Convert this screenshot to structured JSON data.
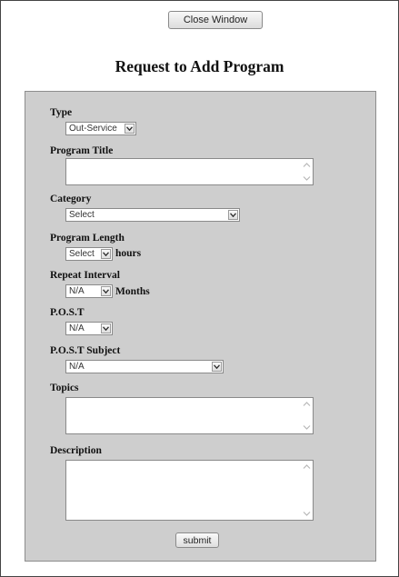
{
  "window": {
    "close_label": "Close Window"
  },
  "page": {
    "title": "Request to Add Program"
  },
  "form": {
    "type": {
      "label": "Type",
      "value": "Out-Service"
    },
    "program_title": {
      "label": "Program Title",
      "value": ""
    },
    "category": {
      "label": "Category",
      "value": "Select"
    },
    "program_length": {
      "label": "Program Length",
      "value": "Select",
      "unit": "hours"
    },
    "repeat_interval": {
      "label": "Repeat Interval",
      "value": "N/A",
      "unit": "Months"
    },
    "post": {
      "label": "P.O.S.T",
      "value": "N/A"
    },
    "post_subject": {
      "label": "P.O.S.T Subject",
      "value": "N/A"
    },
    "topics": {
      "label": "Topics",
      "value": ""
    },
    "description": {
      "label": "Description",
      "value": ""
    },
    "submit_label": "submit"
  },
  "icons": {
    "dropdown": "chevron-down-icon",
    "scroll_up": "scroll-up-icon",
    "scroll_down": "scroll-down-icon"
  },
  "colors": {
    "panel": "#cecece",
    "border": "#8d8d8d"
  }
}
